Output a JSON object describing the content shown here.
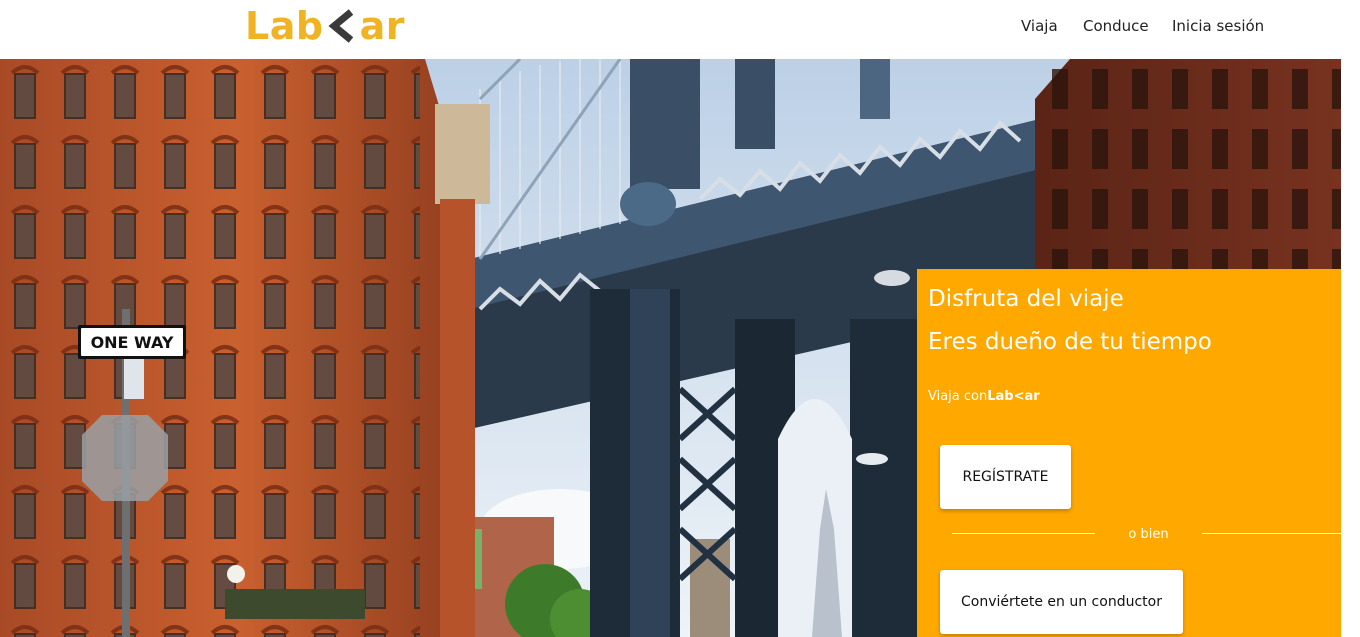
{
  "header": {
    "logo": {
      "left": "Lab",
      "right": "ar",
      "color": "#F0B323",
      "chevron_color": "#3A3A3A"
    },
    "nav": [
      {
        "label": "Viaja"
      },
      {
        "label": "Conduce"
      },
      {
        "label": "Inicia sesión"
      }
    ]
  },
  "hero": {
    "image": "manhattan-bridge-street-photo",
    "sign_text": "ONE WAY"
  },
  "cta": {
    "background": "#FFA800",
    "title_1": "Disfruta del viaje",
    "title_2": "Eres dueño de tu tiempo",
    "subtitle_prefix": "Viaja con",
    "subtitle_brand": "Lab<ar",
    "register_label": "REGÍSTRATE",
    "divider_label": "o bien",
    "driver_label": "Conviértete en un conductor"
  }
}
